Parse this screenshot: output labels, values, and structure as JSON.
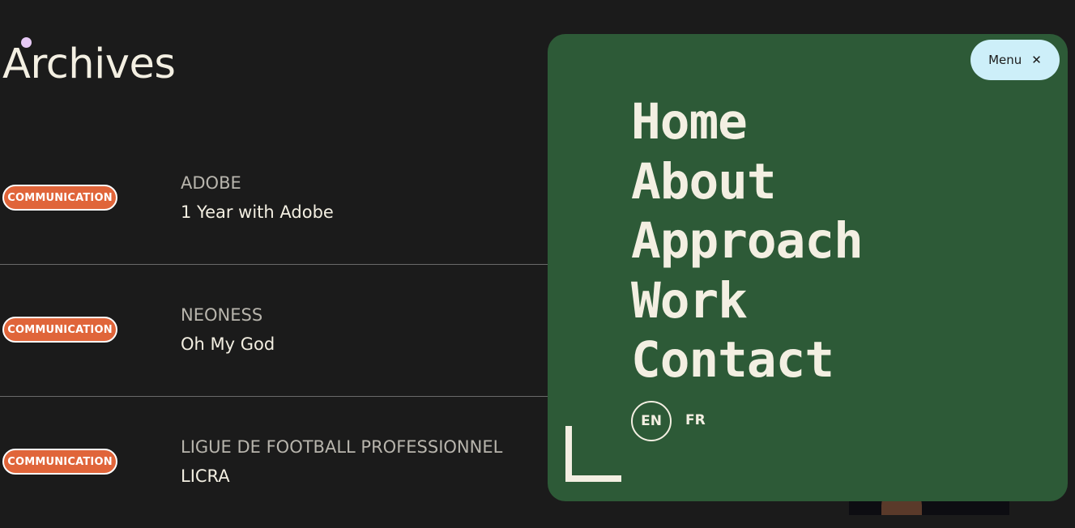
{
  "page": {
    "title": "Archives"
  },
  "archive_rows": [
    {
      "tag": "COMMUNICATION",
      "client": "ADOBE",
      "project": "1 Year with Adobe"
    },
    {
      "tag": "COMMUNICATION",
      "client": "NEONESS",
      "project": "Oh My God"
    },
    {
      "tag": "COMMUNICATION",
      "client": "LIGUE DE FOOTBALL PROFESSIONNEL",
      "project": "LICRA"
    }
  ],
  "menu": {
    "toggle_label": "Menu",
    "close_icon": "close-icon",
    "nav_items": [
      "Home",
      "About",
      "Approach",
      "Work",
      "Contact"
    ],
    "languages": {
      "active": "EN",
      "other": "FR"
    }
  },
  "colors": {
    "background": "#1b1b1b",
    "tag": "#e0653a",
    "menu_panel": "#2d5a37",
    "menu_toggle": "#cdeff9",
    "accent_dot": "#e6c9f5"
  }
}
